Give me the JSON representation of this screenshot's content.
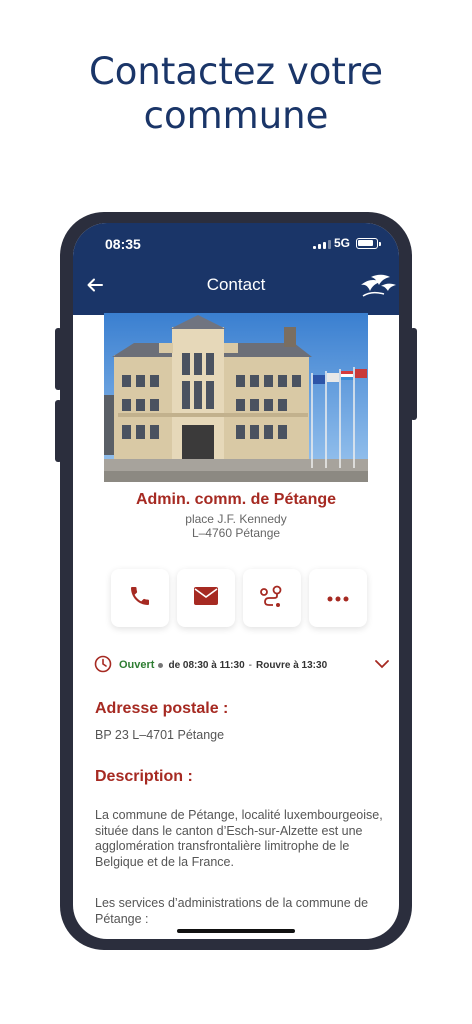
{
  "promo": {
    "title_line1": "Contactez votre",
    "title_line2": "commune"
  },
  "status_bar": {
    "time": "08:35",
    "network": "5G"
  },
  "nav": {
    "title": "Contact",
    "back_icon": "arrow-left-icon",
    "logo_icon": "birds-logo-icon"
  },
  "place": {
    "name": "Admin. comm. de Pétange",
    "street": "place J.F. Kennedy",
    "city": "L–4760 Pétange"
  },
  "actions": [
    {
      "name": "phone",
      "icon": "phone-icon"
    },
    {
      "name": "email",
      "icon": "mail-icon"
    },
    {
      "name": "directions",
      "icon": "route-icon"
    },
    {
      "name": "more",
      "icon": "more-dots-icon"
    }
  ],
  "hours": {
    "status": "Ouvert",
    "range": "de 08:30 à 11:30",
    "separator": "-",
    "reopen": "Rouvre à 13:30"
  },
  "postal": {
    "title": "Adresse postale :",
    "value": "BP 23 L–4701 Pétange"
  },
  "description": {
    "title": "Description :",
    "paragraph1": "La commune de Pétange, localité luxembourgeoise, située dans le canton d’Esch-sur-Alzette est une agglomération transfrontalière limitrophe de le Belgique et de la France.",
    "paragraph2": "Les services d’administrations de la commune de Pétange :"
  },
  "colors": {
    "navy": "#1a3568",
    "accent_red": "#a62a22",
    "open_green": "#2e7d32",
    "frame": "#2b2e3d"
  }
}
